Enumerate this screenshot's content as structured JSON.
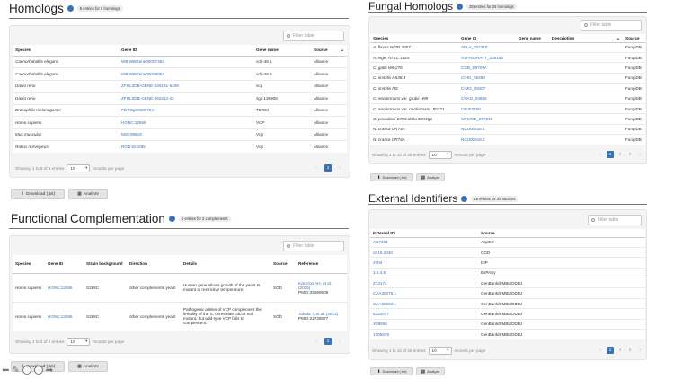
{
  "colors": {
    "link": "#3a73b4",
    "panel": "#f4f4f4",
    "active_page": "#3a73b4"
  },
  "homologs": {
    "title": "Homologs",
    "badge": "8 entries for 8 homologs",
    "filter_placeholder": "Filter table",
    "columns": [
      "Species",
      "Gene ID",
      "Gene name",
      "Source"
    ],
    "rows": [
      [
        "Caenorhabditis elegans",
        "WB:WBGene00007352",
        "cdc-48.1",
        "Alliance"
      ],
      [
        "Caenorhabditis elegans",
        "WB:WBGene00008053",
        "cdc-48.2",
        "Alliance"
      ],
      [
        "Danio rerio",
        "ZFIN:ZDB-GENE-030131-5408",
        "vcp",
        "Alliance"
      ],
      [
        "Danio rerio",
        "ZFIN:ZDB-GENE-060312-22",
        "zgc:136908",
        "Alliance"
      ],
      [
        "Drosophila melanogaster",
        "FB:FBgn0286784",
        "TER94",
        "Alliance"
      ],
      [
        "Homo sapiens",
        "HGNC:12666",
        "VCP",
        "Alliance"
      ],
      [
        "Mus musculus",
        "MGI:99919",
        "Vcp",
        "Alliance"
      ],
      [
        "Rattus norvegicus",
        "RGD:621595",
        "Vcp",
        "Alliance"
      ]
    ],
    "showing": "Showing 1 to 8 of 8 entries",
    "per_page_value": "10",
    "per_page_label": "records per page",
    "page": "1",
    "download_label": "Download (.txt)",
    "analyze_label": "Analyze"
  },
  "functional": {
    "title": "Functional Complementation",
    "badge": "2 entries for 2 complements",
    "filter_placeholder": "Filter table",
    "columns": [
      "Species",
      "Gene ID",
      "Strain background",
      "Direction",
      "Details",
      "Source",
      "Reference"
    ],
    "rows": [
      {
        "species": "Homo sapiens",
        "gene_id": "HGNC:12666",
        "strain": "S288C",
        "direction": "other complements yeast",
        "details": "Human gene allows growth of the yeast ts mutant at restrictive temperature.",
        "source": "SGD",
        "ref_link": "Kachroo AH, et al. (2015)",
        "pmid": "PMID:25999509"
      },
      {
        "species": "Homo sapiens",
        "gene_id": "HGNC:12666",
        "strain": "S288C",
        "direction": "other complements yeast",
        "details": "Pathogenic alleles of VCP complement the lethality of the S. cerevisiae cdc48 null mutant, but wild-type VCP fails to complement.",
        "source": "SGD",
        "ref_link": "Takata T, et al. (2013)",
        "pmid": "PMID:22728077"
      }
    ],
    "showing": "Showing 1 to 2 of 2 entries",
    "per_page_value": "10",
    "per_page_label": "records per page",
    "page": "1",
    "download_label": "Download (.txt)",
    "analyze_label": "Analyze"
  },
  "fungal": {
    "title": "Fungal Homologs",
    "badge": "25 entries for 25 homologs",
    "filter_placeholder": "Filter table",
    "columns": [
      "Species",
      "Gene ID",
      "Gene name",
      "Description",
      "Source"
    ],
    "rows": [
      [
        "A. flavus NRRL3357",
        "AFLA_002370",
        "",
        "",
        "FungiDB"
      ],
      [
        "A. niger ATCC 1015",
        "ASPNIDRAFT_205183",
        "",
        "",
        "FungiDB"
      ],
      [
        "C. gattii WM276",
        "CGB_D670W",
        "",
        "",
        "FungiDB"
      ],
      [
        "C. immitis H538.4",
        "CIHG_05360",
        "",
        "",
        "FungiDB"
      ],
      [
        "C. immitis RS",
        "CIMG_09407",
        "",
        "",
        "FungiDB"
      ],
      [
        "C. neoformans var. grubii H99",
        "CNAG_04855",
        "",
        "",
        "FungiDB"
      ],
      [
        "C. neoformans var. neoformans JEC21",
        "CNJ03750",
        "",
        "",
        "FungiDB"
      ],
      [
        "C. posadasii C735 delta SOWgp",
        "CPC735_057810",
        "",
        "",
        "FungiDB"
      ],
      [
        "N. crassa OR74A",
        "NCU00018.1",
        "",
        "",
        "FungiDB"
      ],
      [
        "N. crassa OR74A",
        "NCU00018.2",
        "",
        "",
        "FungiDB"
      ]
    ],
    "showing": "Showing 1 to 10 of 25 entries",
    "per_page_value": "10",
    "per_page_label": "records per page",
    "pages": [
      "1",
      "2",
      "3"
    ],
    "download_label": "Download (.txt)",
    "analyze_label": "Analyze"
  },
  "external": {
    "title": "External Identifiers",
    "badge": "25 entries for 25 sources",
    "filter_placeholder": "Filter table",
    "columns": [
      "External ID",
      "Source"
    ],
    "rows": [
      [
        "AN7254",
        "AspGD"
      ],
      [
        "orf19.2340",
        "CGD"
      ],
      [
        "2704",
        "DIP"
      ],
      [
        "3.6.4.6",
        "ExPASy"
      ],
      [
        "Z74174",
        "GenBank/EMBL/DDBJ"
      ],
      [
        "CAA40276.1",
        "GenBank/EMBL/DDBJ"
      ],
      [
        "CAA98694.1",
        "GenBank/EMBL/DDBJ"
      ],
      [
        "6320077",
        "GenBank/EMBL/DDBJ"
      ],
      [
        "X59956",
        "GenBank/EMBL/DDBJ"
      ],
      [
        "1705679",
        "GenBank/EMBL/DDBJ"
      ]
    ],
    "showing": "Showing 1 to 10 of 25 entries",
    "per_page_value": "10",
    "per_page_label": "records per page",
    "pages": [
      "1",
      "2",
      "3"
    ],
    "download_label": "Download (.txt)",
    "analyze_label": "Analyze"
  }
}
